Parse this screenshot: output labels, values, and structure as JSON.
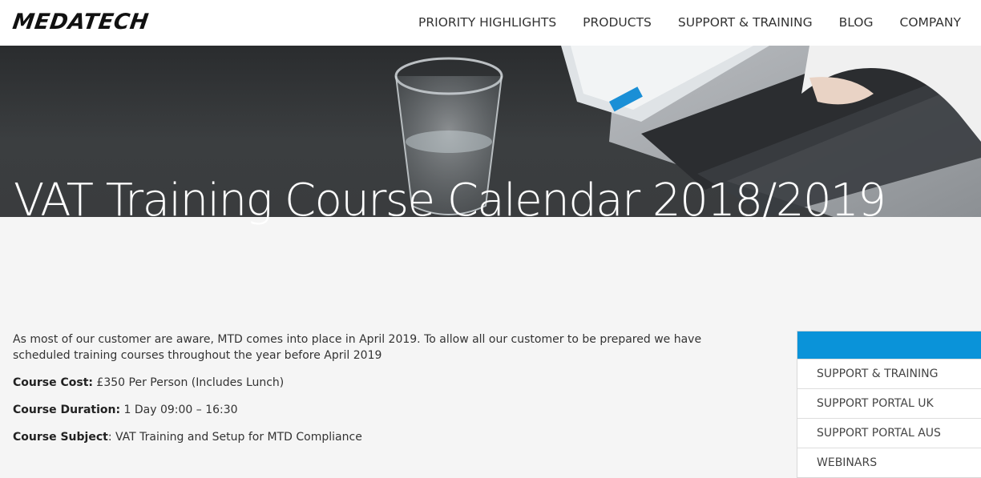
{
  "brand": {
    "name": "MEDATECH"
  },
  "nav": {
    "items": [
      "PRIORITY HIGHLIGHTS",
      "PRODUCTS",
      "SUPPORT & TRAINING",
      "BLOG",
      "COMPANY"
    ]
  },
  "hero": {
    "title": "VAT Training Course Calendar 2018/2019"
  },
  "content": {
    "intro": "As most of our customer are aware, MTD comes into place in April 2019. To allow all our customer to be prepared we have scheduled training courses throughout the year before April 2019",
    "cost_label": "Course Cost:",
    "cost_value": " £350 Per Person (Includes Lunch)",
    "duration_label": "Course Duration:",
    "duration_value": " 1 Day 09:00 – 16:30",
    "subject_label": "Course Subject",
    "subject_value": ": VAT Training and Setup for MTD Compliance"
  },
  "sidebar": {
    "items": [
      "SUPPORT & TRAINING",
      "SUPPORT PORTAL UK",
      "SUPPORT PORTAL AUS",
      "WEBINARS"
    ]
  },
  "colors": {
    "accent": "#0a93d9",
    "hero_bg": "#3a3c3e",
    "text": "#333333"
  }
}
